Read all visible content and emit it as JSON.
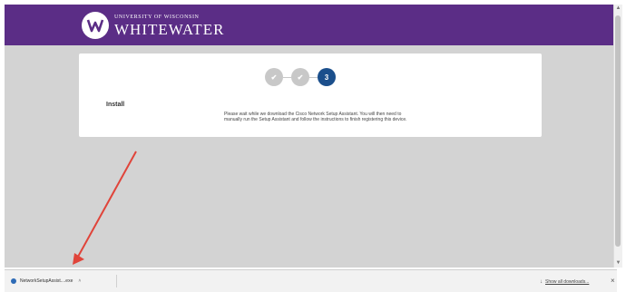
{
  "header": {
    "logo_top": "UNIVERSITY OF WISCONSIN",
    "logo_main": "WHITEWATER",
    "background": "#5b2d86"
  },
  "steps": {
    "items": [
      {
        "state": "done",
        "label": "✔"
      },
      {
        "state": "done",
        "label": "✔"
      },
      {
        "state": "active",
        "label": "3"
      }
    ],
    "active_color": "#1b4f8c",
    "done_color": "#c8c8c8"
  },
  "card": {
    "heading": "Install",
    "body": "Please wait while we download the Cisco Network Setup Assistant. You will then need to manually run the Setup Assistant and follow the instructions to finish registering this device."
  },
  "download_bar": {
    "file_name": "NetworkSetupAssist....exe",
    "caret": "˄",
    "download_icon": "↓",
    "show_all_label": "Show all downloads...",
    "close_label": "×"
  },
  "annotation": {
    "arrow_color": "#e0443a"
  }
}
